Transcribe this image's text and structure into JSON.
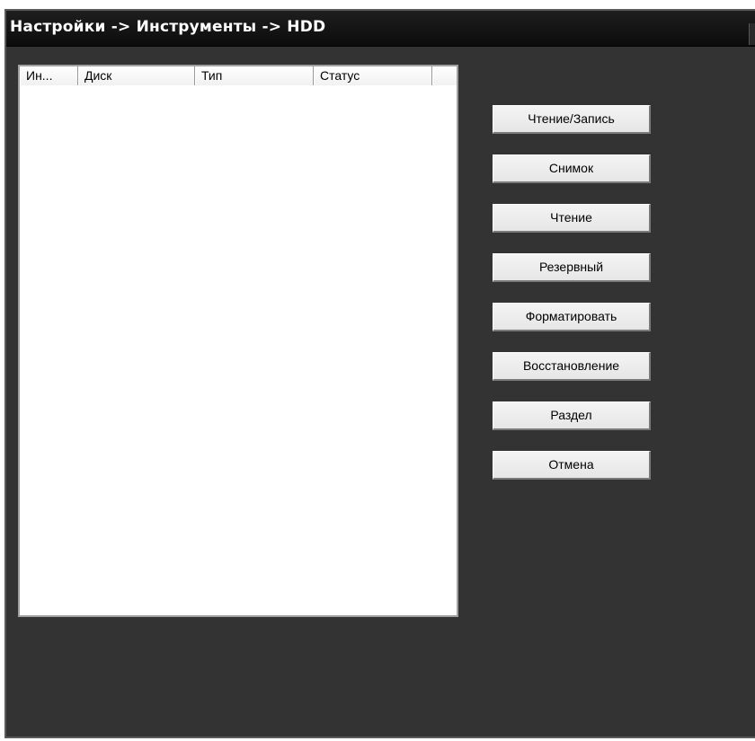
{
  "window": {
    "title": "Настройки -> Инструменты -> HDD"
  },
  "disk_table": {
    "columns": [
      "Ин...",
      "Диск",
      "Тип",
      "Статус",
      ""
    ],
    "rows": []
  },
  "actions": [
    {
      "label": "Чтение/Запись"
    },
    {
      "label": "Снимок"
    },
    {
      "label": "Чтение"
    },
    {
      "label": "Резервный"
    },
    {
      "label": "Форматировать"
    },
    {
      "label": "Восстановление"
    },
    {
      "label": "Раздел"
    },
    {
      "label": "Отмена"
    }
  ],
  "colors": {
    "panel_background": "#333333",
    "title_bar": "#111111",
    "title_text": "#ffffff",
    "table_background": "#ffffff",
    "button_face": "#eeeeee"
  }
}
